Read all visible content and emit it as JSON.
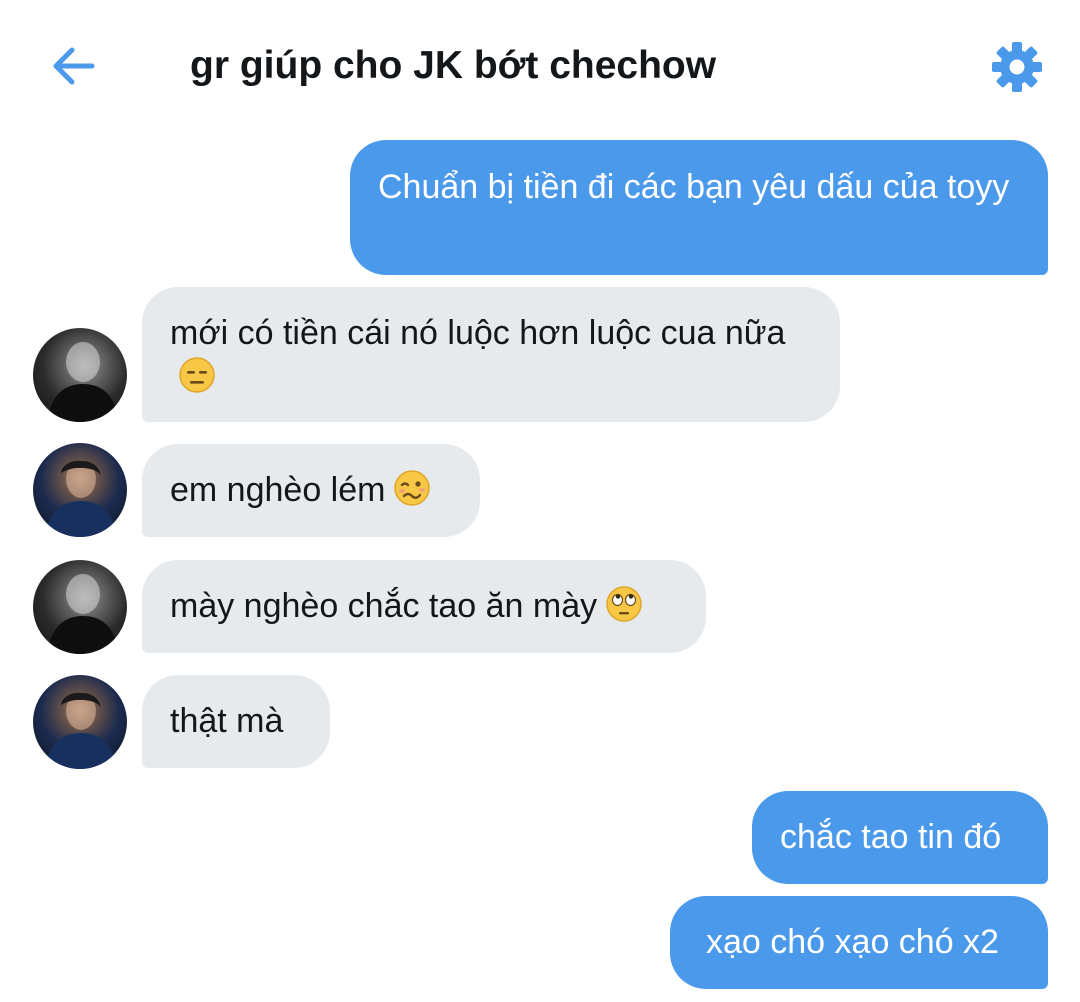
{
  "header": {
    "title": "gr giúp cho JK bớt chechow",
    "back_icon": "arrow-left-icon",
    "settings_icon": "gear-icon",
    "accent_color": "#4a99ea"
  },
  "messages": [
    {
      "direction": "outgoing",
      "text": "Chuẩn bị tiền đi các bạn yêu dấu của toyy"
    },
    {
      "direction": "incoming",
      "avatar": "avatar-gray",
      "text": "mới có tiền cái nó luộc hơn luộc cua nữa",
      "emoji": "expressionless-face-emoji"
    },
    {
      "direction": "incoming",
      "avatar": "avatar-blue",
      "text": "em nghèo lém",
      "emoji": "woozy-face-emoji"
    },
    {
      "direction": "incoming",
      "avatar": "avatar-gray",
      "text": "mày nghèo chắc tao ăn mày",
      "emoji": "eye-roll-face-emoji"
    },
    {
      "direction": "incoming",
      "avatar": "avatar-blue",
      "text": "thật mà"
    },
    {
      "direction": "outgoing",
      "text": "chắc tao tin đó"
    },
    {
      "direction": "outgoing",
      "text": "xạo chó xạo chó x2"
    }
  ],
  "colors": {
    "outgoing_bubble": "#4a99ea",
    "incoming_bubble": "#e7eaed"
  }
}
